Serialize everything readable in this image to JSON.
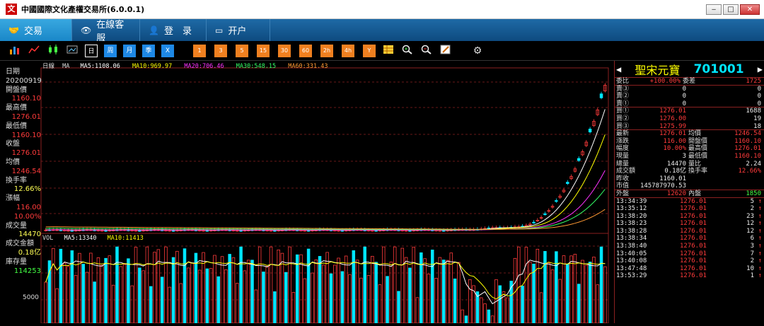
{
  "window": {
    "title": "中國國際文化產權交易所(6.0.0.1)",
    "logo_char": "文"
  },
  "nav_tabs": [
    {
      "label": "交易",
      "icon": "🤝"
    },
    {
      "label": "在線客服",
      "icon": "👁"
    },
    {
      "label": "登　录",
      "icon": "👤"
    },
    {
      "label": "开户",
      "icon": "▭"
    }
  ],
  "toolbar": {
    "chart_tools": [
      "bar-chart-icon",
      "line-chart-icon",
      "candle-icon",
      "image-icon"
    ],
    "periods": [
      "日",
      "周",
      "月",
      "季",
      "X"
    ],
    "selected_period": "日",
    "minutes": [
      "1",
      "3",
      "5",
      "15",
      "30",
      "60",
      "2h",
      "4h",
      "Y"
    ],
    "extra_tools": [
      "grid-icon",
      "zoom-in-icon",
      "zoom-out-icon",
      "edit-icon",
      "gear-icon"
    ]
  },
  "colors": {
    "up": "#ff3b3b",
    "down": "#00e5ff",
    "ma5": "#ffffff",
    "ma10": "#ffff00",
    "ma20": "#ff33ff",
    "ma30": "#33ff66",
    "ma60": "#ff9933"
  },
  "main_chart": {
    "period_label": "日線",
    "ma_label": "MA",
    "ma5": "MA5:1108.06",
    "ma10": "MA10:969.97",
    "ma20": "MA20:706.46",
    "ma30": "MA30:548.15",
    "ma60": "MA60:331.43",
    "top_price": "1276.01"
  },
  "volume_chart": {
    "vol_label": "VOL",
    "ma5": "MA5:13340",
    "ma10": "MA10:11413",
    "axis_label": "5000"
  },
  "side_info": [
    {
      "label": "日期",
      "value": "20200919",
      "color": "wht"
    },
    {
      "label": "開盤價",
      "value": "1160.10",
      "color": "red"
    },
    {
      "label": "最高價",
      "value": "1276.01",
      "color": "red"
    },
    {
      "label": "最低價",
      "value": "1160.10",
      "color": "red"
    },
    {
      "label": "收盤",
      "value": "1276.01",
      "color": "red"
    },
    {
      "label": "均價",
      "value": "1246.54",
      "color": "red"
    },
    {
      "label": "換手率",
      "value": "12.66%",
      "color": "yel"
    },
    {
      "label": "漲幅",
      "value": "116.00",
      "color": "red"
    },
    {
      "label": "",
      "value": "10.00%",
      "color": "red"
    },
    {
      "label": "成交量",
      "value": "14470",
      "color": "yel"
    },
    {
      "label": "成交金額",
      "value": "0.18亿",
      "color": "yel"
    },
    {
      "label": "庫存量",
      "value": "114253",
      "color": "grn"
    }
  ],
  "quote": {
    "name": "聖宋元寶",
    "code": "701001",
    "weibi_label": "委比",
    "weibi_value": "+100.00%",
    "weicha_label": "委差",
    "weicha_value": "1725",
    "sells": [
      {
        "label": "賣③",
        "price": "0",
        "vol": "0"
      },
      {
        "label": "賣②",
        "price": "0",
        "vol": "0"
      },
      {
        "label": "賣①",
        "price": "0",
        "vol": "0"
      }
    ],
    "buys": [
      {
        "label": "買①",
        "price": "1276.01",
        "vol": "1688"
      },
      {
        "label": "買②",
        "price": "1276.00",
        "vol": "19"
      },
      {
        "label": "買③",
        "price": "1275.99",
        "vol": "18"
      }
    ],
    "stats": [
      {
        "l1": "最新",
        "v1": "1276.01",
        "l2": "均價",
        "v2": "1246.54",
        "c1": "red",
        "c2": "red"
      },
      {
        "l1": "漲跌",
        "v1": "116.00",
        "l2": "開盤價",
        "v2": "1160.10",
        "c1": "red",
        "c2": "red"
      },
      {
        "l1": "幅度",
        "v1": "10.00%",
        "l2": "最高價",
        "v2": "1276.01",
        "c1": "red",
        "c2": "red"
      },
      {
        "l1": "現量",
        "v1": "3",
        "l2": "最低價",
        "v2": "1160.10",
        "c1": "wht",
        "c2": "red"
      },
      {
        "l1": "總量",
        "v1": "14470",
        "l2": "量比",
        "v2": "2.24",
        "c1": "wht",
        "c2": "wht"
      },
      {
        "l1": "成交額",
        "v1": "0.18亿",
        "l2": "換手率",
        "v2": "12.66%",
        "c1": "wht",
        "c2": "red"
      },
      {
        "l1": "昨收",
        "v1": "1160.01",
        "l2": "",
        "v2": "",
        "c1": "wht",
        "c2": "wht"
      },
      {
        "l1": "市值",
        "v1": "145787970.53",
        "l2": "",
        "v2": "",
        "c1": "wht",
        "c2": "wht"
      }
    ],
    "waipan_label": "外盤",
    "waipan_value": "12620",
    "neipan_label": "內盤",
    "neipan_value": "1850",
    "ticks": [
      {
        "time": "13:34:39",
        "price": "1276.01",
        "vol": "5",
        "dir": "↑"
      },
      {
        "time": "13:35:12",
        "price": "1276.01",
        "vol": "2",
        "dir": "↑"
      },
      {
        "time": "13:38:20",
        "price": "1276.01",
        "vol": "23",
        "dir": "↑"
      },
      {
        "time": "13:38:23",
        "price": "1276.01",
        "vol": "12",
        "dir": "↑"
      },
      {
        "time": "13:38:28",
        "price": "1276.01",
        "vol": "12",
        "dir": "↑"
      },
      {
        "time": "13:38:34",
        "price": "1276.01",
        "vol": "6",
        "dir": "↑"
      },
      {
        "time": "13:38:40",
        "price": "1276.01",
        "vol": "3",
        "dir": "↑"
      },
      {
        "time": "13:40:05",
        "price": "1276.01",
        "vol": "7",
        "dir": "↑"
      },
      {
        "time": "13:40:08",
        "price": "1276.01",
        "vol": "2",
        "dir": "↑"
      },
      {
        "time": "13:47:48",
        "price": "1276.01",
        "vol": "10",
        "dir": "↑"
      },
      {
        "time": "13:53:29",
        "price": "1276.01",
        "vol": "1",
        "dir": "↑"
      }
    ]
  }
}
